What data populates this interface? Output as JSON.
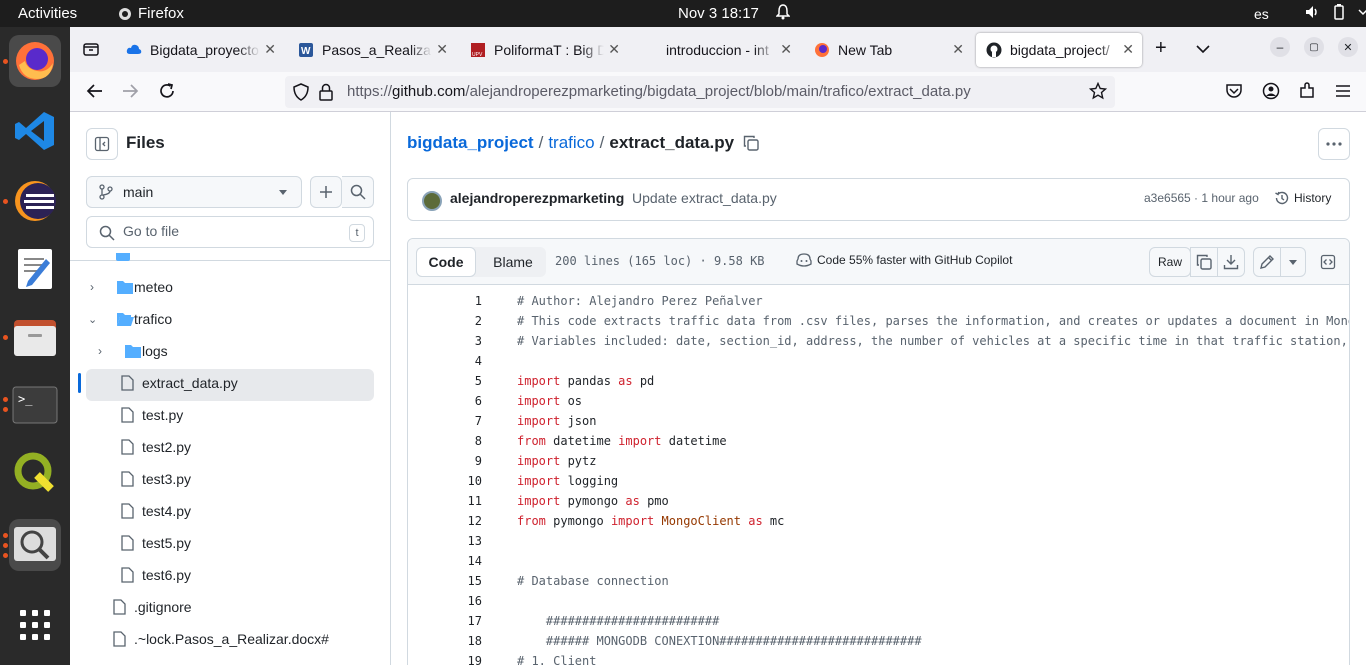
{
  "topbar": {
    "activities": "Activities",
    "app_name": "Firefox",
    "datetime": "Nov 3  18:17",
    "language": "es"
  },
  "dock": {
    "apps": [
      "firefox-icon",
      "vscode-icon",
      "eclipse-icon",
      "text-editor-icon",
      "files-icon",
      "terminal-icon",
      "qgis-icon",
      "image-viewer-icon",
      "app-grid-icon"
    ]
  },
  "tabs": [
    {
      "title": "Bigdata_proyecto",
      "icon": "cloud-icon"
    },
    {
      "title": "Pasos_a_Realizar",
      "icon": "word-icon"
    },
    {
      "title": "PoliformaT : Big D",
      "icon": "upv-icon"
    },
    {
      "title": "introduccion - int",
      "icon": "none"
    },
    {
      "title": "New Tab",
      "icon": "firefox-icon"
    },
    {
      "title": "bigdata_project/",
      "icon": "github-icon"
    }
  ],
  "url": {
    "prefix": "https://",
    "domain": "github.com",
    "path": "/alejandroperezpmarketing/bigdata_project/blob/main/trafico/extract_data.py"
  },
  "sidebar": {
    "title": "Files",
    "branch": "main",
    "search_placeholder": "Go to file",
    "search_shortcut": "t",
    "tree": [
      {
        "label": "meteo",
        "type": "folder",
        "expanded": false
      },
      {
        "label": "trafico",
        "type": "folder",
        "expanded": true
      },
      {
        "label": "logs",
        "type": "folder",
        "expanded": false
      },
      {
        "label": "extract_data.py",
        "type": "file",
        "selected": true
      },
      {
        "label": "test.py",
        "type": "file"
      },
      {
        "label": "test2.py",
        "type": "file"
      },
      {
        "label": "test3.py",
        "type": "file"
      },
      {
        "label": "test4.py",
        "type": "file"
      },
      {
        "label": "test5.py",
        "type": "file"
      },
      {
        "label": "test6.py",
        "type": "file"
      },
      {
        "label": ".gitignore",
        "type": "file"
      },
      {
        "label": ".~lock.Pasos_a_Realizar.docx#",
        "type": "file"
      }
    ]
  },
  "breadcrumb": {
    "repo": "bigdata_project",
    "sep1": "/",
    "folder": "trafico",
    "sep2": "/",
    "file": "extract_data.py"
  },
  "commit": {
    "author": "alejandroperezpmarketing",
    "message": "Update extract_data.py",
    "hash_time": "a3e6565 · 1 hour ago",
    "history_label": "History"
  },
  "toolbar": {
    "code_tab": "Code",
    "blame_tab": "Blame",
    "stats": "200 lines (165 loc) · 9.58 KB",
    "copilot": "Code 55% faster with GitHub Copilot",
    "raw": "Raw"
  },
  "code_lines": [
    {
      "n": "1",
      "text": "# Author: Alejandro Perez Peñalver"
    },
    {
      "n": "2",
      "text": "# This code extracts traffic data from .csv files, parses the information, and creates or updates a document in MongoD"
    },
    {
      "n": "3",
      "text": "# Variables included: date, section_id, address, the number of vehicles at a specific time in that traffic station, an"
    },
    {
      "n": "4",
      "text": ""
    },
    {
      "n": "5",
      "text": "import pandas as pd"
    },
    {
      "n": "6",
      "text": "import os"
    },
    {
      "n": "7",
      "text": "import json"
    },
    {
      "n": "8",
      "text": "from datetime import datetime"
    },
    {
      "n": "9",
      "text": "import pytz"
    },
    {
      "n": "10",
      "text": "import logging"
    },
    {
      "n": "11",
      "text": "import pymongo as pmo"
    },
    {
      "n": "12",
      "text": "from pymongo import MongoClient as mc"
    },
    {
      "n": "13",
      "text": ""
    },
    {
      "n": "14",
      "text": ""
    },
    {
      "n": "15",
      "text": "# Database connection"
    },
    {
      "n": "16",
      "text": ""
    },
    {
      "n": "17",
      "text": "    ########################"
    },
    {
      "n": "18",
      "text": "    ###### MONGODB CONEXTION############################"
    },
    {
      "n": "19",
      "text": "# 1. Client"
    }
  ]
}
